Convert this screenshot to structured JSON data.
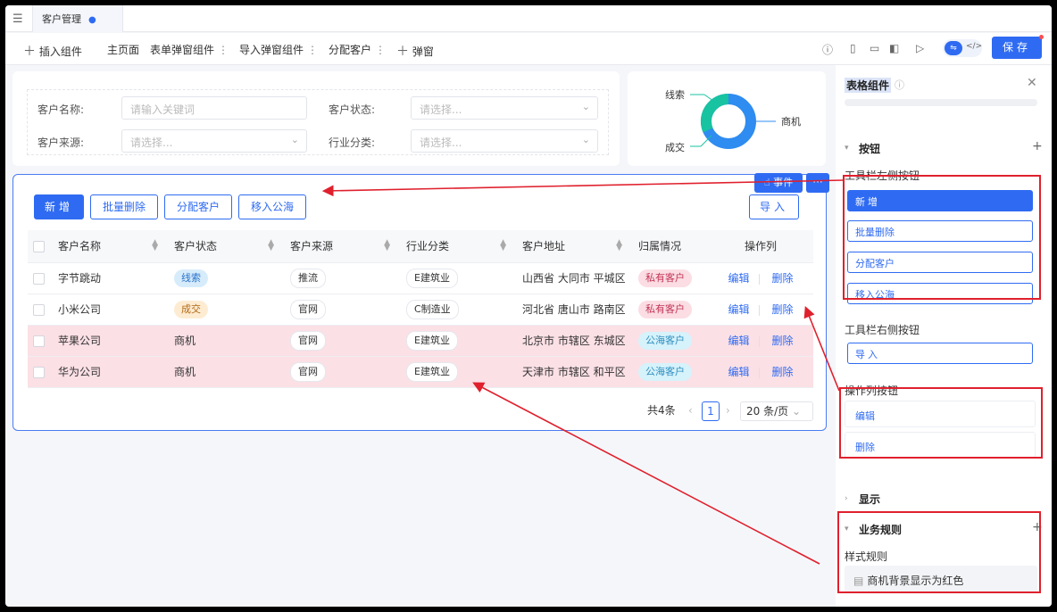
{
  "tabbar": {
    "menu_icon": "collapse-menu-icon",
    "tab_label": "客户管理",
    "tab_dot": "●"
  },
  "toolbar": {
    "insert": "插入组件",
    "items": [
      "主页面",
      "表单弹窗组件",
      "导入弹窗组件",
      "分配客户"
    ],
    "popup": "弹窗",
    "save": "保存"
  },
  "filter": {
    "name_label": "客户名称:",
    "name_placeholder": "请输入关键词",
    "status_label": "客户状态:",
    "status_placeholder": "请选择...",
    "source_label": "客户来源:",
    "source_placeholder": "请选择...",
    "industry_label": "行业分类:",
    "industry_placeholder": "请选择..."
  },
  "donut": {
    "labels": [
      "线索",
      "商机",
      "成交"
    ],
    "colors": {
      "green": "#17c3a0",
      "blue": "#2f8cf0"
    }
  },
  "table": {
    "toolbar": {
      "add": "新增",
      "batch_delete": "批量删除",
      "assign": "分配客户",
      "move_pool": "移入公海",
      "import": "导入"
    },
    "event_btn": "事件",
    "more_btn": "···",
    "columns": [
      "客户名称",
      "客户状态",
      "客户来源",
      "行业分类",
      "客户地址",
      "归属情况",
      "操作列"
    ],
    "rows": [
      {
        "name": "字节跳动",
        "status": "线索",
        "status_color": "blue",
        "source": "推流",
        "industry": "E建筑业",
        "address": "山西省 大同市 平城区",
        "owner": "私有客户",
        "owner_color": "pink",
        "highlight": false
      },
      {
        "name": "小米公司",
        "status": "成交",
        "status_color": "orange",
        "source": "官网",
        "industry": "C制造业",
        "address": "河北省 唐山市 路南区",
        "owner": "私有客户",
        "owner_color": "pink",
        "highlight": false
      },
      {
        "name": "苹果公司",
        "status": "商机",
        "status_color": "none",
        "source": "官网",
        "industry": "E建筑业",
        "address": "北京市 市辖区 东城区",
        "owner": "公海客户",
        "owner_color": "cyan",
        "highlight": true
      },
      {
        "name": "华为公司",
        "status": "商机",
        "status_color": "none",
        "source": "官网",
        "industry": "E建筑业",
        "address": "天津市 市辖区 和平区",
        "owner": "公海客户",
        "owner_color": "cyan",
        "highlight": true
      }
    ],
    "op_edit": "编辑",
    "op_delete": "删除",
    "pager": {
      "total": "共4条",
      "page": "1",
      "size": "20 条/页"
    }
  },
  "panel": {
    "title": "表格组件",
    "buttons_section": "按钮",
    "left_label": "工具栏左侧按钮",
    "left_buttons": [
      "新增",
      "批量删除",
      "分配客户",
      "移入公海"
    ],
    "right_label": "工具栏右侧按钮",
    "right_buttons": [
      "导入"
    ],
    "op_label": "操作列按钮",
    "op_buttons": [
      "编辑",
      "删除"
    ],
    "display_section": "显示",
    "rules_section": "业务规则",
    "style_label": "样式规则",
    "rule_item": "商机背景显示为红色"
  },
  "colors": {
    "accent": "#2f6bf2",
    "annotation": "#e0202d",
    "highlight_row": "#fbe0e6"
  }
}
